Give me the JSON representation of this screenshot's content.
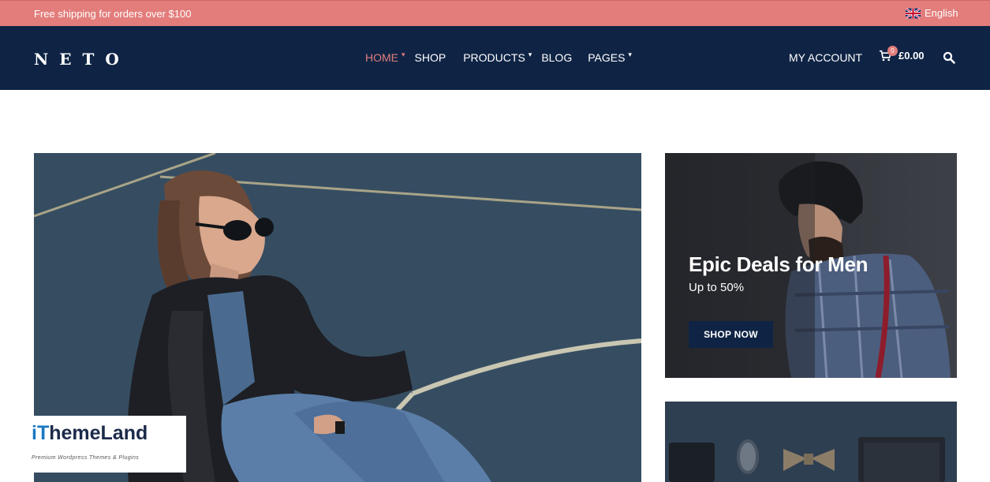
{
  "topbar": {
    "shipping_text": "Free shipping for orders over $100",
    "language": "English"
  },
  "header": {
    "logo": "NETO",
    "nav": [
      {
        "label": "HOME",
        "active": true,
        "dropdown": true
      },
      {
        "label": "SHOP",
        "active": false,
        "dropdown": false
      },
      {
        "label": "PRODUCTS",
        "active": false,
        "dropdown": true
      },
      {
        "label": "BLOG",
        "active": false,
        "dropdown": false
      },
      {
        "label": "PAGES",
        "active": false,
        "dropdown": true
      }
    ],
    "account_label": "MY ACCOUNT",
    "cart_count": "0",
    "cart_total": "£0.00",
    "icons": [
      "flag-uk-icon",
      "chevron-down-icon",
      "cart-icon",
      "search-icon"
    ]
  },
  "promo": {
    "title": "Epic Deals for Men",
    "subtitle": "Up to 50%",
    "button_label": "SHOP NOW"
  },
  "watermark": {
    "brand_prefix": "iT",
    "brand_rest": "hemeLand",
    "tagline": "Premium Wordpress Themes & Plugins"
  },
  "colors": {
    "accent": "#e27d7b",
    "header_bg": "#0f2445",
    "button_bg": "#0f2445"
  }
}
